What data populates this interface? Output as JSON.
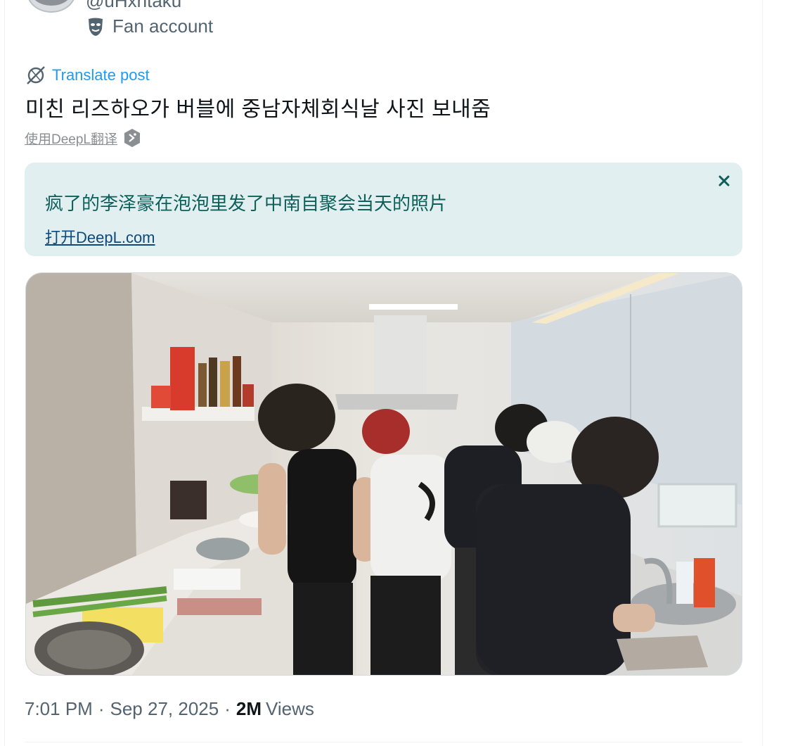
{
  "author": {
    "handle": "@uHxhtaku",
    "label_icon": "theater-mask-icon",
    "label": "Fan account"
  },
  "translate": {
    "icon": "globe-icon",
    "label": "Translate post"
  },
  "post": {
    "text": "미친 리즈하오가 버블에 중남자체회식날 사진 보내줌"
  },
  "deepl": {
    "link_label": "使用DeepL翻译",
    "icon": "deepl-icon",
    "translated_text": "疯了的李泽豪在泡泡里发了中南自聚会当天的照片",
    "open_label": "打开DeepL.com",
    "close_icon": "close-icon"
  },
  "media": {
    "description_icon": "photo"
  },
  "meta": {
    "time": "7:01 PM",
    "date": "Sep 27, 2025",
    "views_count": "2M",
    "views_label": "Views"
  },
  "colors": {
    "link_blue": "#1d9bf0",
    "deepl_bg": "#e2eff0",
    "deepl_text": "#0d5f5a",
    "muted": "#536471"
  }
}
